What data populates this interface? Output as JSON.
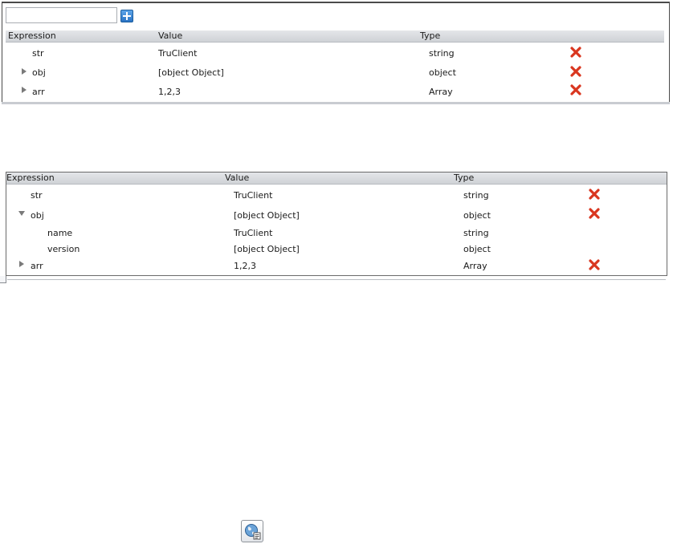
{
  "watch_panel": {
    "input_value": "",
    "input_placeholder": "",
    "add_button_icon": "plus-icon",
    "columns": [
      "Expression",
      "Value",
      "Type"
    ],
    "rows": [
      {
        "expression": "str",
        "value": "TruClient",
        "type": "string",
        "expandable": false,
        "delete_icon": "delete-icon"
      },
      {
        "expression": "obj",
        "value": "[object Object]",
        "type": "object",
        "expandable": true,
        "expanded": false,
        "delete_icon": "delete-icon"
      },
      {
        "expression": "arr",
        "value": "1,2,3",
        "type": "Array",
        "expandable": true,
        "expanded": false,
        "delete_icon": "delete-icon"
      }
    ]
  },
  "expanded_panel": {
    "columns": [
      "Expression",
      "Value",
      "Type"
    ],
    "rows": [
      {
        "expression": "str",
        "value": "TruClient",
        "type": "string",
        "expandable": false,
        "delete_icon": "delete-icon"
      },
      {
        "expression": "obj",
        "value": "[object Object]",
        "type": "object",
        "expandable": true,
        "expanded": true,
        "delete_icon": "delete-icon"
      },
      {
        "expression": "name",
        "value": "TruClient",
        "type": "string",
        "child": true
      },
      {
        "expression": "version",
        "value": "[object Object]",
        "type": "object",
        "child": true
      },
      {
        "expression": "arr",
        "value": "1,2,3",
        "type": "Array",
        "expandable": true,
        "expanded": false,
        "delete_icon": "delete-icon"
      }
    ]
  },
  "bottom_icon": "globe-icon",
  "colors": {
    "header_bg": "#d7dadd",
    "delete_red": "#d9361f",
    "add_blue": "#2a73c4"
  }
}
